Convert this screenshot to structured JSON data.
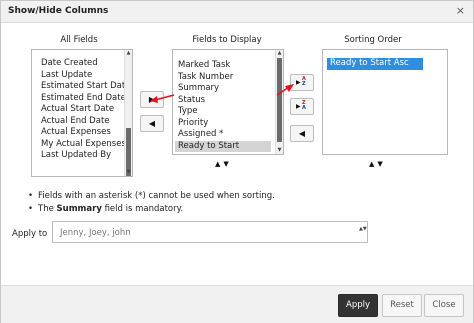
{
  "dialog": {
    "title": "Show/Hide Columns",
    "close_glyph": "×"
  },
  "all_fields": {
    "header": "All Fields",
    "items": [
      "Date Created",
      "Last Update",
      "Estimated Start Date",
      "Estimated End Date",
      "Actual Start Date",
      "Actual End Date",
      "Actual Expenses",
      "My Actual Expenses",
      "Last Updated By"
    ]
  },
  "fields_to_display": {
    "header": "Fields to Display",
    "items": [
      "Marked Task",
      "Task Number",
      "Summary",
      "Status",
      "Type",
      "Priority",
      "Assigned *",
      "Ready to Start"
    ],
    "selected": "Ready to Start"
  },
  "sorting_order": {
    "header": "Sorting Order",
    "items": [
      "Ready to Start Asc"
    ],
    "selected": "Ready to Start Asc"
  },
  "buttons": {
    "move_right": "▶",
    "move_left": "◀",
    "sort_tri": "▶",
    "sort_asc_top": "A",
    "sort_asc_bottom": "Z",
    "sort_desc_top": "Z",
    "sort_desc_bottom": "A",
    "sort_remove": "◀",
    "up_down": "▲▼",
    "scroll_up": "▲",
    "scroll_down": "▼"
  },
  "notes": {
    "asterisk_note": "Fields with an asterisk (*) cannot be used when sorting.",
    "mandatory_prefix": "The ",
    "mandatory_field": "Summary",
    "mandatory_suffix": " field is mandatory."
  },
  "apply_to": {
    "label": "Apply to",
    "value": "Jenny, Joey, john",
    "arrows": "▲▼"
  },
  "footer": {
    "apply": "Apply",
    "reset": "Reset",
    "close": "Close"
  },
  "colors": {
    "selection_blue": "#2e8fe0",
    "selection_grey": "#d4d4d4",
    "annotation_red": "#e0141e",
    "apply_button": "#333333"
  },
  "icons": {
    "annotation": "red-pointer-arrow-icon"
  }
}
